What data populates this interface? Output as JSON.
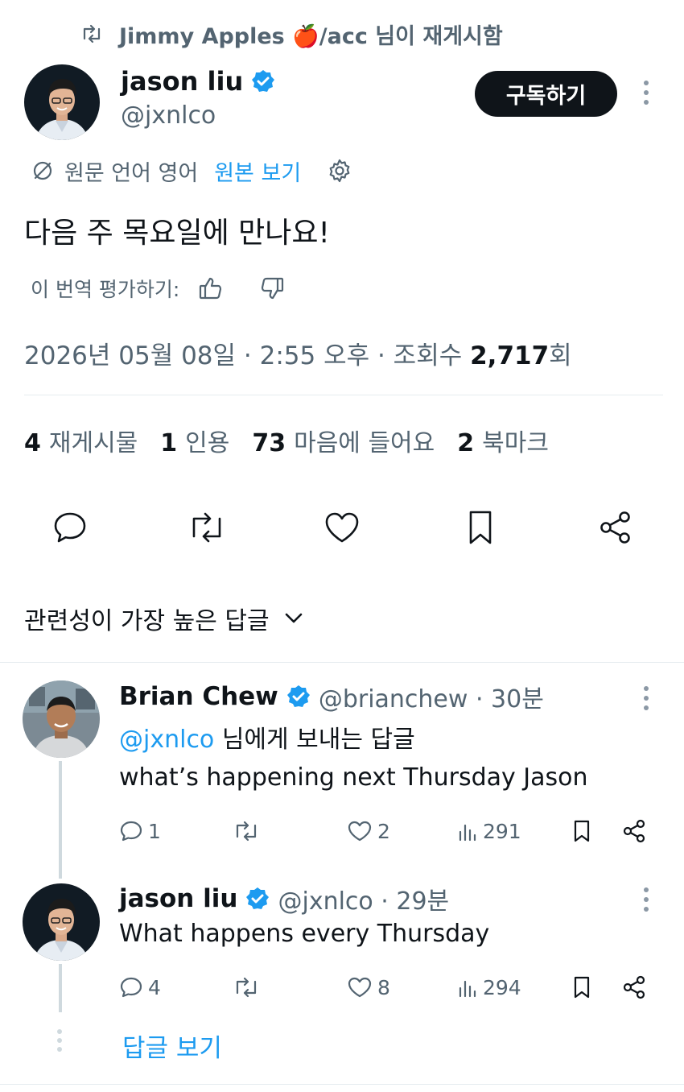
{
  "repost": {
    "user": "Jimmy Apples",
    "suffix": "/acc 님이 재게시함",
    "emoji": "🍎"
  },
  "author": {
    "name": "jason liu",
    "handle": "@jxnlco",
    "verified": true
  },
  "subscribe_label": "구독하기",
  "translation": {
    "source_label": "원문 언어 영어",
    "show_original": "원본 보기"
  },
  "tweet": {
    "text": "다음 주 목요일에 만나요!",
    "rate_label": "이 번역 평가하기:",
    "timestamp": "2026년 05월 08일 · 2:55 오후 · 조회수",
    "views": "2,717",
    "views_suffix": "회"
  },
  "stats": [
    {
      "count": "4",
      "label": "재게시물"
    },
    {
      "count": "1",
      "label": "인용"
    },
    {
      "count": "73",
      "label": "마음에 들어요"
    },
    {
      "count": "2",
      "label": "북마크"
    }
  ],
  "sort_label": "관련성이 가장 높은 답글",
  "replies": [
    {
      "name": "Brian Chew",
      "meta": "@brianchew · 30분",
      "reply_to_handle": "@jxnlco",
      "reply_to_suffix": " 님에게 보내는 답글",
      "text": "what’s happening next Thursday Jason",
      "replies": "1",
      "likes": "2",
      "views": "291"
    },
    {
      "name": "jason liu",
      "meta": "@jxnlco · 29분",
      "text": "What happens every Thursday",
      "replies": "4",
      "likes": "8",
      "views": "294"
    }
  ],
  "show_replies_label": "답글 보기",
  "colors": {
    "accent": "#1d9bf0",
    "text": "#0f1419",
    "muted": "#536471",
    "button_dark": "#0f1419"
  }
}
